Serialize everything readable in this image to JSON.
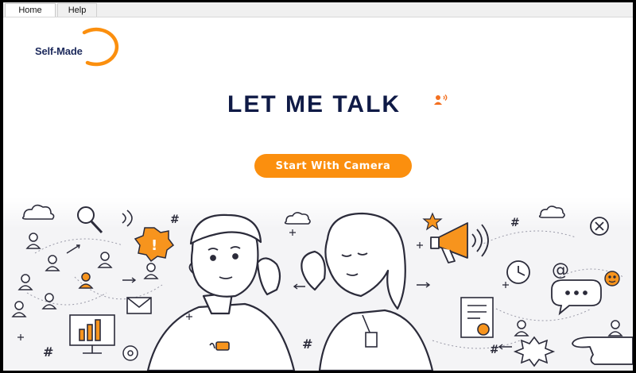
{
  "tabs": [
    {
      "label": "Home",
      "active": true
    },
    {
      "label": "Help",
      "active": false
    }
  ],
  "logo": {
    "text": "Self-Made",
    "accent_color": "#fb8f0e"
  },
  "hero": {
    "title": "LET ME TALK",
    "title_color": "#0f1a46",
    "icon": "speaking-person-icon"
  },
  "cta": {
    "label": "Start With Camera",
    "color": "#fb8f0e"
  },
  "illustration": {
    "subject": "two-people-whispering-illustration",
    "accent_color": "#f7941d",
    "line_color": "#2b2b3a"
  }
}
